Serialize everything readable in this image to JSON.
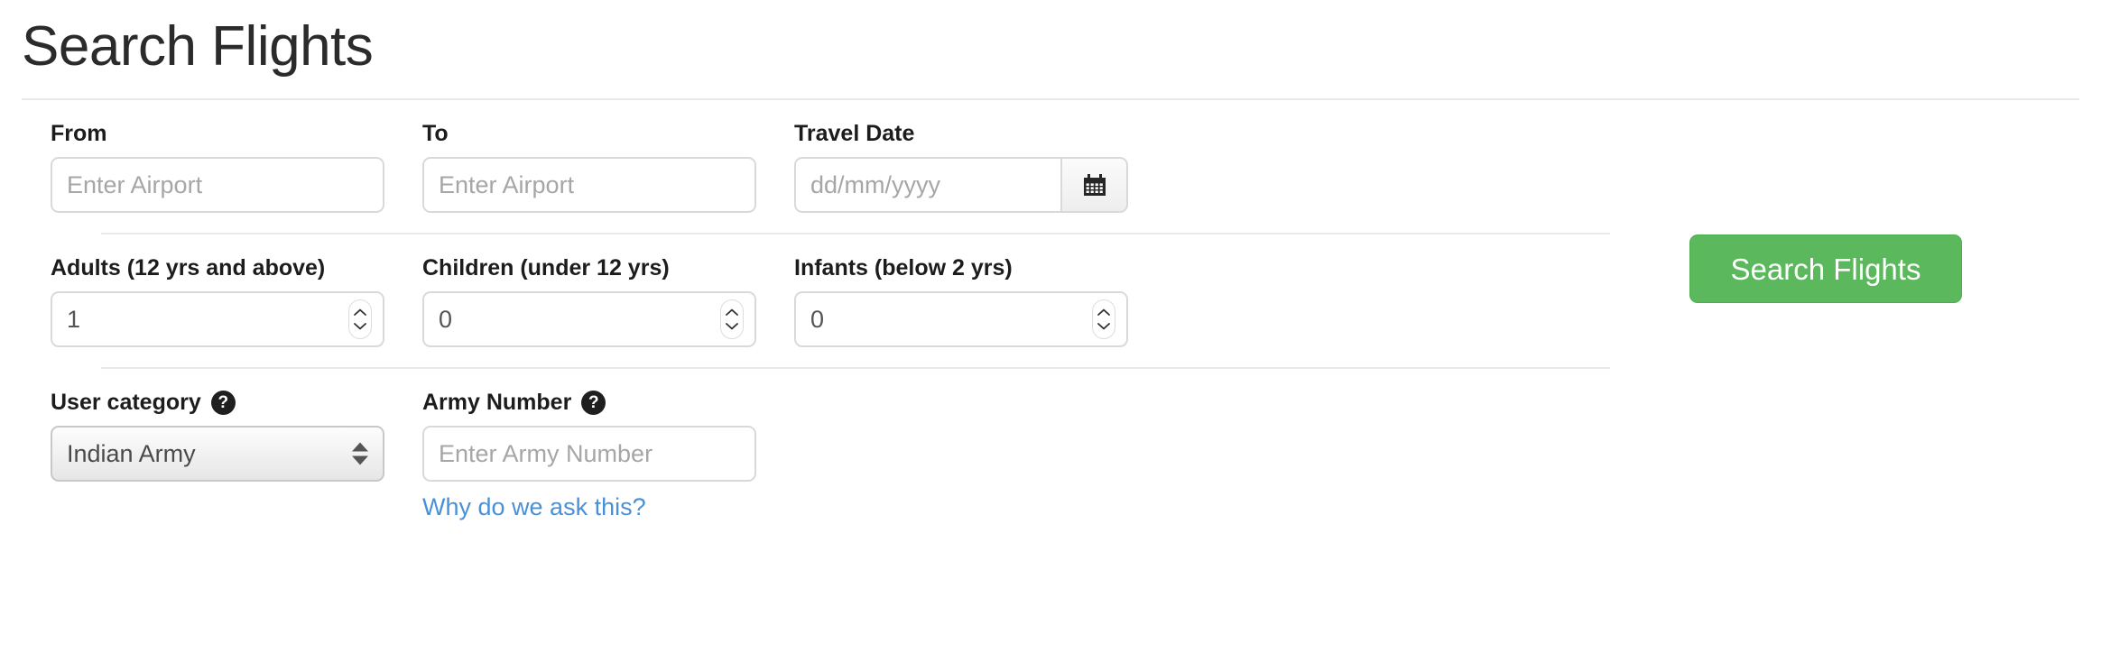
{
  "header": {
    "title": "Search Flights"
  },
  "form": {
    "route": {
      "from": {
        "label": "From",
        "placeholder": "Enter Airport",
        "value": ""
      },
      "to": {
        "label": "To",
        "placeholder": "Enter Airport",
        "value": ""
      },
      "travel_date": {
        "label": "Travel Date",
        "placeholder": "dd/mm/yyyy",
        "value": "",
        "calendar_icon": "calendar-icon"
      }
    },
    "passengers": {
      "adults": {
        "label": "Adults (12 yrs and above)",
        "value": "1"
      },
      "children": {
        "label": "Children (under 12 yrs)",
        "value": "0"
      },
      "infants": {
        "label": "Infants (below 2 yrs)",
        "value": "0"
      }
    },
    "category": {
      "user_category": {
        "label": "User category",
        "help_icon": "question-mark-icon",
        "selected": "Indian Army"
      },
      "army_number": {
        "label": "Army Number",
        "help_icon": "question-mark-icon",
        "placeholder": "Enter Army Number",
        "value": "",
        "link_text": "Why do we ask this?"
      }
    }
  },
  "actions": {
    "search_button": "Search Flights"
  },
  "colors": {
    "button_green": "#5cb85c",
    "link_blue": "#4a90d9",
    "label_dark": "#1c1c1c",
    "border_gray": "#d9d9d9"
  }
}
